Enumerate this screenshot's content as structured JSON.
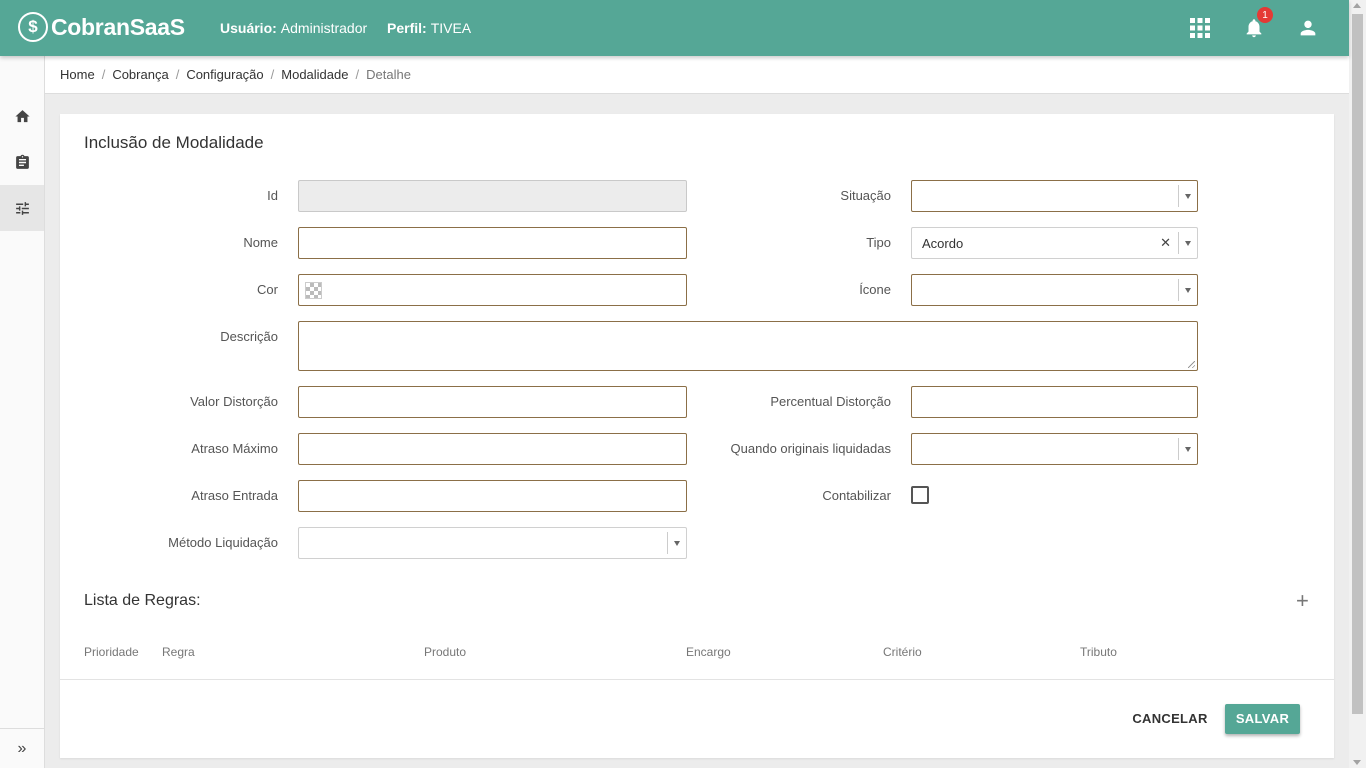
{
  "app": {
    "logo_text": "CobranSaaS",
    "logo_mark": "$"
  },
  "header": {
    "user_label": "Usuário:",
    "user_value": "Administrador",
    "profile_label": "Perfil:",
    "profile_value": "TIVEA",
    "notification_count": "1",
    "icons": [
      "apps-grid-icon",
      "bell-icon",
      "account-icon"
    ]
  },
  "sidebar": {
    "items": [
      "home-icon",
      "clipboard-icon",
      "tune-sliders-icon"
    ],
    "active_index": 2,
    "expand_label": "»"
  },
  "breadcrumb": {
    "items": [
      "Home",
      "Cobrança",
      "Configuração",
      "Modalidade",
      "Detalhe"
    ]
  },
  "form": {
    "title": "Inclusão de Modalidade",
    "fields": {
      "id": {
        "label": "Id",
        "value": ""
      },
      "nome": {
        "label": "Nome",
        "value": ""
      },
      "cor": {
        "label": "Cor",
        "value": ""
      },
      "descricao": {
        "label": "Descrição",
        "value": ""
      },
      "valor_distorcao": {
        "label": "Valor Distorção",
        "value": ""
      },
      "atraso_maximo": {
        "label": "Atraso Máximo",
        "value": ""
      },
      "atraso_entrada": {
        "label": "Atraso Entrada",
        "value": ""
      },
      "metodo_liquidacao": {
        "label": "Método Liquidação",
        "value": ""
      },
      "situacao": {
        "label": "Situação",
        "value": ""
      },
      "tipo": {
        "label": "Tipo",
        "value": "Acordo"
      },
      "icone": {
        "label": "Ícone",
        "value": ""
      },
      "percentual_distorcao": {
        "label": "Percentual Distorção",
        "value": ""
      },
      "quando_originais": {
        "label": "Quando originais liquidadas",
        "value": ""
      },
      "contabilizar": {
        "label": "Contabilizar",
        "checked": false
      }
    }
  },
  "rules": {
    "title": "Lista de Regras:",
    "add_label": "+",
    "columns": [
      "Prioridade",
      "Regra",
      "Produto",
      "Encargo",
      "Critério",
      "Tributo"
    ]
  },
  "actions": {
    "cancel": "CANCELAR",
    "save": "SALVAR"
  },
  "colors": {
    "primary": "#55a796",
    "input_border": "#8b6f47",
    "badge": "#e53935"
  }
}
